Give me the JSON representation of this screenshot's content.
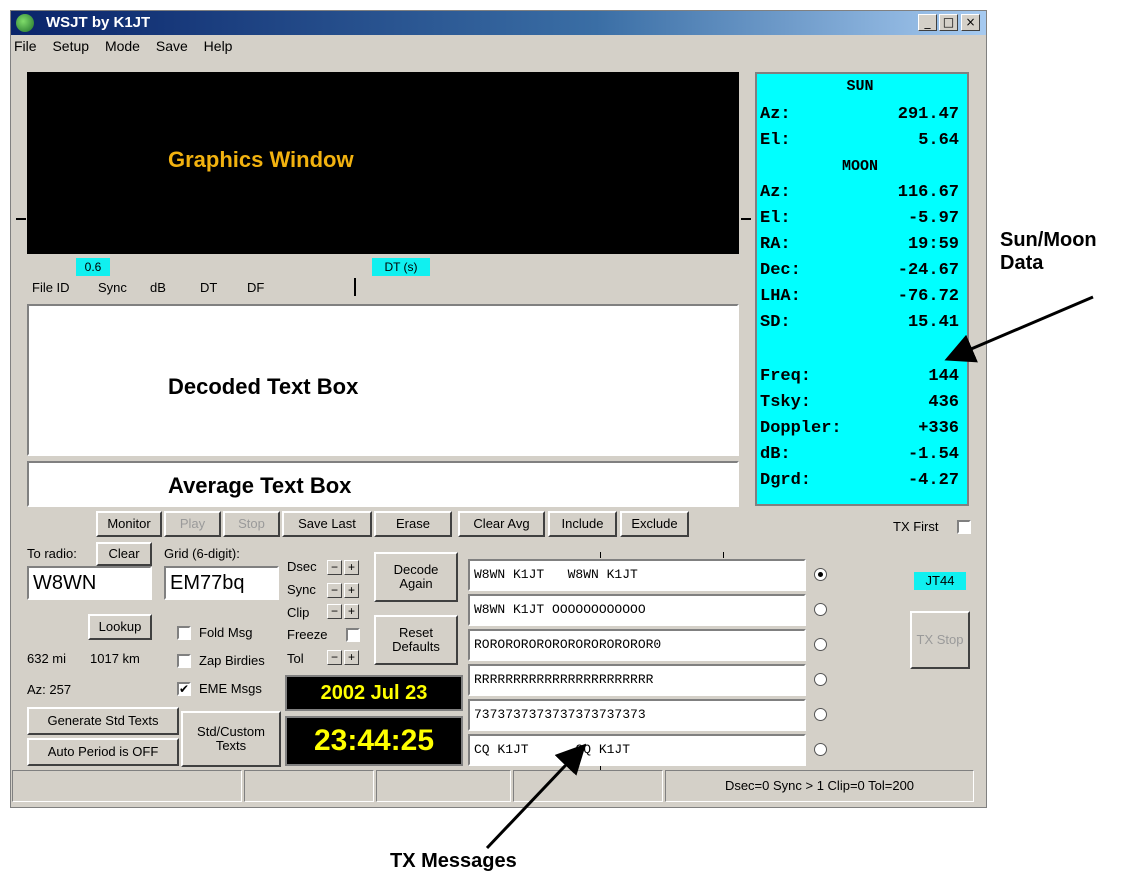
{
  "window": {
    "title": "WSJT  by K1JT",
    "controls": {
      "minimize": "_",
      "maximize": "□",
      "close": "×"
    }
  },
  "menu": {
    "items": [
      "File",
      "Setup",
      "Mode",
      "Save",
      "Help"
    ]
  },
  "graphics": {
    "label": "Graphics Window"
  },
  "header_row": {
    "sync_tag": "0.6",
    "dt_tag": "DT (s)",
    "file_id": "File ID",
    "sync": "Sync",
    "db": "dB",
    "dt": "DT",
    "df": "DF"
  },
  "decoded_box": {
    "label": "Decoded Text Box"
  },
  "average_box": {
    "label": "Average Text Box"
  },
  "sun_moon": {
    "sun_header": "SUN",
    "sun_rows": [
      {
        "key": "Az:",
        "value": "291.47"
      },
      {
        "key": "El:",
        "value": "5.64"
      }
    ],
    "moon_header": "MOON",
    "moon_rows": [
      {
        "key": "Az:",
        "value": "116.67"
      },
      {
        "key": "El:",
        "value": "-5.97"
      },
      {
        "key": "RA:",
        "value": "19:59"
      },
      {
        "key": "Dec:",
        "value": "-24.67"
      },
      {
        "key": "LHA:",
        "value": "-76.72"
      },
      {
        "key": "SD:",
        "value": "15.41"
      }
    ],
    "extra_rows": [
      {
        "key": "Freq:",
        "value": "144"
      },
      {
        "key": "Tsky:",
        "value": "436"
      },
      {
        "key": "Doppler:",
        "value": "+336"
      },
      {
        "key": "dB:",
        "value": "-1.54"
      },
      {
        "key": "Dgrd:",
        "value": "-4.27"
      }
    ]
  },
  "toolbar": {
    "monitor": "Monitor",
    "play": "Play",
    "stop": "Stop",
    "save_last": "Save Last",
    "erase": "Erase",
    "clear_avg": "Clear Avg",
    "include": "Include",
    "exclude": "Exclude",
    "tx_first": "TX First"
  },
  "left_panel": {
    "to_radio_label": "To radio:",
    "clear": "Clear",
    "to_radio_value": "W8WN",
    "grid_label": "Grid (6-digit):",
    "grid_value": "EM77bq",
    "lookup": "Lookup",
    "distance_mi": "632 mi",
    "distance_km": "1017 km",
    "azimuth": "Az: 257",
    "fold_msg": "Fold Msg",
    "zap_birdies": "Zap Birdies",
    "eme_msgs": "EME Msgs",
    "eme_check_mark": "✔",
    "generate_std_texts": "Generate Std Texts",
    "auto_period": "Auto Period is OFF",
    "std_custom_texts": "Std/Custom Texts"
  },
  "decode_controls": {
    "dsec": "Dsec",
    "sync": "Sync",
    "clip": "Clip",
    "freeze": "Freeze",
    "tol": "Tol",
    "minus": "−",
    "plus": "+",
    "decode_again": "Decode Again",
    "reset_defaults": "Reset Defaults"
  },
  "clock": {
    "date": "2002 Jul 23",
    "time": "23:44:25"
  },
  "tx_messages": [
    "W8WN K1JT   W8WN K1JT",
    "W8WN K1JT OOOOOOOOOOOO",
    "ROROROROROROROROROROROR0",
    "RRRRRRRRRRRRRRRRRRRRRRR",
    "7373737373737373737373",
    "CQ K1JT      CQ K1JT"
  ],
  "tx_selected_index": 0,
  "mode_tag": "JT44",
  "tx_stop": "TX Stop",
  "status_bar": {
    "right": "Dsec=0  Sync > 1  Clip=0  Tol=200"
  },
  "callouts": {
    "sun_moon": "Sun/Moon\nData",
    "tx_messages": "TX Messages"
  }
}
